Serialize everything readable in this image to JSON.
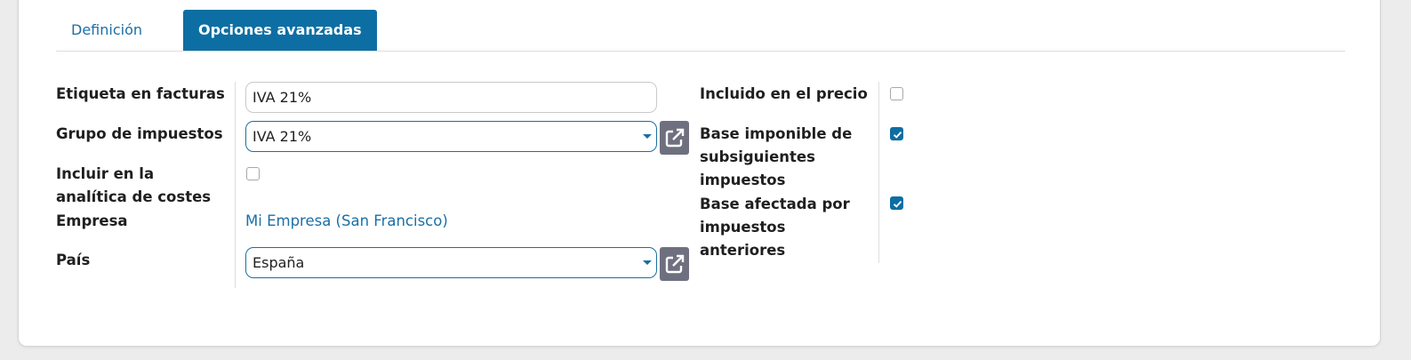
{
  "tabs": {
    "definition": "Definición",
    "advanced": "Opciones avanzadas"
  },
  "left_fields": {
    "invoice_label": {
      "label": "Etiqueta en facturas",
      "value": "IVA 21%"
    },
    "tax_group": {
      "label": "Grupo de impuestos",
      "value": "IVA 21%"
    },
    "analytic": {
      "label_lines": [
        "Incluir en la",
        "analítica de costes"
      ],
      "checked": false
    },
    "company": {
      "label": "Empresa",
      "value": "Mi Empresa (San Francisco)"
    },
    "country": {
      "label": "País",
      "value": "España"
    }
  },
  "right_fields": {
    "price_include": {
      "label": "Incluido en el precio",
      "checked": false
    },
    "include_base": {
      "label_lines": [
        "Base imponible de",
        "subsiguientes",
        "impuestos"
      ],
      "checked": true
    },
    "affected_base": {
      "label_lines": [
        "Base afectada por",
        "impuestos",
        "anteriores"
      ],
      "checked": true
    }
  },
  "icons": {
    "external_link": "external-link-icon",
    "dropdown": "caret-down-icon",
    "check": "check-icon"
  },
  "colors": {
    "accent": "#0d6ea3",
    "link": "#1b6fa8",
    "button_gray": "#6f707f"
  }
}
